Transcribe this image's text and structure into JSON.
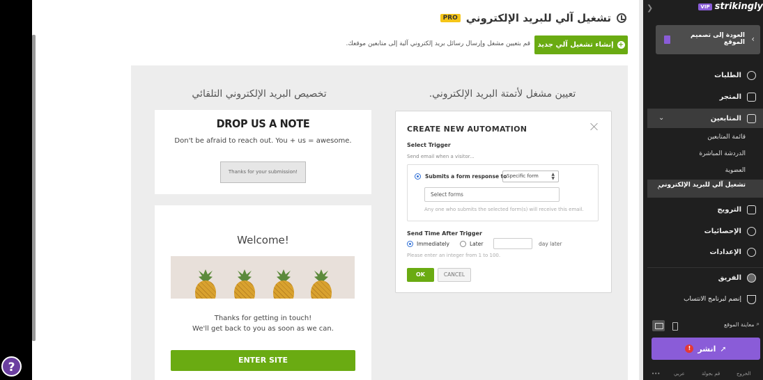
{
  "page": {
    "title": "تشغيل آلي للبريد الإلكتروني",
    "badge": "PRO",
    "create_button": "إنشاء تشغيل آلي جديد",
    "create_description": "قم بتعيين مشغل وإرسال رسائل بريد إلكتروني آلية إلى متابعين موقعك."
  },
  "help": {
    "label": "?"
  },
  "panel": {
    "left_heading": "تخصيص البريد الإلكتروني التلقائي",
    "right_heading": "تعيين مشغل لأتمتة البريد الإلكتروني.",
    "note_card": {
      "title": "DROP US A NOTE",
      "subtitle": "Don't be afraid to reach out. You + us = awesome.",
      "button": "Thanks for your submission!"
    },
    "welcome_card": {
      "title": "Welcome!",
      "line1": "Thanks for getting in touch!",
      "line2": "We'll get back to you as soon as we can.",
      "button": "ENTER SITE"
    }
  },
  "modal": {
    "title": "CREATE NEW AUTOMATION",
    "select_trigger": "Select Trigger",
    "send_email_when": "Send email when a visitor...",
    "option_label": "Submits a form response to",
    "dropdown_value": "Specific form",
    "forms_placeholder": "Select forms",
    "any_one_note": "Any one who submits the selected form(s) will receive this email.",
    "send_time_label": "Send Time After Trigger",
    "immediately": "Immediately",
    "later": "Later",
    "day_later": "day later",
    "integer_hint": "Please enter an integer from 1 to 100.",
    "ok": "OK",
    "cancel": "CANCEL"
  },
  "sidebar": {
    "logo": "strikingly",
    "vip": "VIP",
    "back": "العودة إلى تصميم الموقع",
    "items": {
      "orders": "الطلبات",
      "store": "المتجر",
      "followers": "المتابعين",
      "followers_list": "قائمة المتابعين",
      "live_chat": "الدردشة المباشرة",
      "membership": "العضوية",
      "email_automation": "تشغيل آلي للبريد الإلكتروني",
      "marketing": "الترويج",
      "stats": "الإحصائيات",
      "settings": "الإعدادات",
      "team": "الفريق",
      "affiliate": "إنضم لبرنامج الانتساب"
    },
    "preview": "معاينة الموقع",
    "publish": "انشر",
    "alert": "!",
    "footer": {
      "more": "•••",
      "lang": "عربي",
      "tour": "قم بجولة",
      "exit": "الخروج"
    }
  }
}
